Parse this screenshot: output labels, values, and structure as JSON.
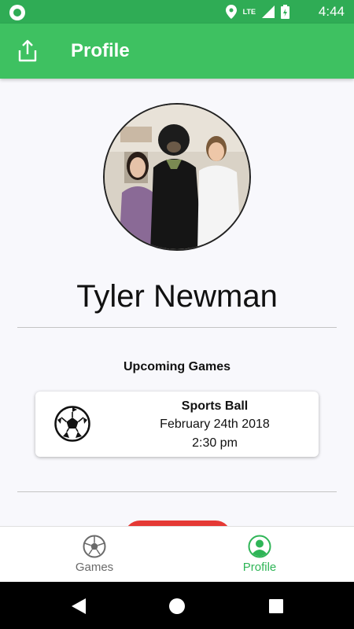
{
  "status_bar": {
    "time": "4:44",
    "network": "LTE",
    "icons": [
      "location-icon",
      "signal-icon",
      "battery-icon"
    ]
  },
  "app_bar": {
    "title": "Profile",
    "share_icon": "share-icon"
  },
  "profile": {
    "name": "Tyler Newman",
    "avatar_icon": "profile-photo"
  },
  "upcoming": {
    "title": "Upcoming Games",
    "games": [
      {
        "name": "Sports Ball",
        "date": "February 24th 2018",
        "time": "2:30 pm",
        "icon": "soccer-ball-icon"
      }
    ]
  },
  "bottom_nav": {
    "items": [
      {
        "label": "Games",
        "icon": "soccer-ball-icon",
        "active": false
      },
      {
        "label": "Profile",
        "icon": "profile-icon",
        "active": true
      }
    ]
  },
  "colors": {
    "status_bar": "#2fac55",
    "app_bar": "#3ec161",
    "accent": "#2fb557",
    "button": "#e53935"
  }
}
